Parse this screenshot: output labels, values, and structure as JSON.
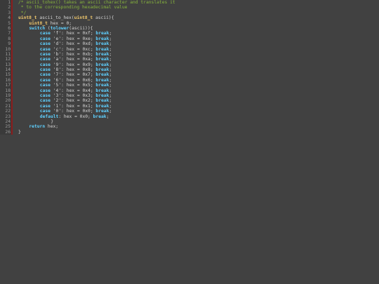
{
  "editor": {
    "lines": [
      {
        "n": "1",
        "indent": 0,
        "tokens": [
          {
            "t": "comment",
            "v": "/* ascii_tohex() takes an ascii character and translates it"
          }
        ]
      },
      {
        "n": "2",
        "indent": 0,
        "tokens": [
          {
            "t": "comment",
            "v": " * to the corresponding hexadecimal value"
          }
        ]
      },
      {
        "n": "3",
        "indent": 0,
        "tokens": [
          {
            "t": "comment",
            "v": " */"
          }
        ]
      },
      {
        "n": "4",
        "indent": 0,
        "tokens": [
          {
            "t": "type",
            "v": "uint8_t"
          },
          {
            "t": "plain",
            "v": " ascii_to_hex("
          },
          {
            "t": "type",
            "v": "uint8_t"
          },
          {
            "t": "plain",
            "v": " ascii){"
          }
        ]
      },
      {
        "n": "5",
        "indent": 4,
        "tokens": [
          {
            "t": "type",
            "v": "uint8_t"
          },
          {
            "t": "plain",
            "v": " hex = 0;"
          }
        ]
      },
      {
        "n": "6",
        "indent": 4,
        "tokens": [
          {
            "t": "kw",
            "v": "switch"
          },
          {
            "t": "plain",
            "v": " ("
          },
          {
            "t": "kw",
            "v": "tolower"
          },
          {
            "t": "plain",
            "v": "(ascii)){"
          }
        ]
      },
      {
        "n": "7",
        "indent": 8,
        "tokens": [
          {
            "t": "kw",
            "v": "case"
          },
          {
            "t": "plain",
            "v": " 'f': hex = 0xf; "
          },
          {
            "t": "kw",
            "v": "break"
          },
          {
            "t": "plain",
            "v": ";"
          }
        ]
      },
      {
        "n": "8",
        "indent": 8,
        "tokens": [
          {
            "t": "kw",
            "v": "case"
          },
          {
            "t": "plain",
            "v": " 'e': hex = 0xe; "
          },
          {
            "t": "kw",
            "v": "break"
          },
          {
            "t": "plain",
            "v": ";"
          }
        ]
      },
      {
        "n": "9",
        "indent": 8,
        "tokens": [
          {
            "t": "kw",
            "v": "case"
          },
          {
            "t": "plain",
            "v": " 'd': hex = 0xd; "
          },
          {
            "t": "kw",
            "v": "break"
          },
          {
            "t": "plain",
            "v": ";"
          }
        ]
      },
      {
        "n": "10",
        "indent": 8,
        "tokens": [
          {
            "t": "kw",
            "v": "case"
          },
          {
            "t": "plain",
            "v": " 'c': hex = 0xc; "
          },
          {
            "t": "kw",
            "v": "break"
          },
          {
            "t": "plain",
            "v": ";"
          }
        ]
      },
      {
        "n": "11",
        "indent": 8,
        "tokens": [
          {
            "t": "kw",
            "v": "case"
          },
          {
            "t": "plain",
            "v": " 'b': hex = 0xb; "
          },
          {
            "t": "kw",
            "v": "break"
          },
          {
            "t": "plain",
            "v": ";"
          }
        ]
      },
      {
        "n": "12",
        "indent": 8,
        "tokens": [
          {
            "t": "kw",
            "v": "case"
          },
          {
            "t": "plain",
            "v": " 'a': hex = 0xa; "
          },
          {
            "t": "kw",
            "v": "break"
          },
          {
            "t": "plain",
            "v": ";"
          }
        ]
      },
      {
        "n": "13",
        "indent": 8,
        "tokens": [
          {
            "t": "kw",
            "v": "case"
          },
          {
            "t": "plain",
            "v": " '9': hex = 0x9; "
          },
          {
            "t": "kw",
            "v": "break"
          },
          {
            "t": "plain",
            "v": ";"
          }
        ]
      },
      {
        "n": "14",
        "indent": 8,
        "tokens": [
          {
            "t": "kw",
            "v": "case"
          },
          {
            "t": "plain",
            "v": " '8': hex = 0x8; "
          },
          {
            "t": "kw",
            "v": "break"
          },
          {
            "t": "plain",
            "v": ";"
          }
        ]
      },
      {
        "n": "15",
        "indent": 8,
        "tokens": [
          {
            "t": "kw",
            "v": "case"
          },
          {
            "t": "plain",
            "v": " '7': hex = 0x7; "
          },
          {
            "t": "kw",
            "v": "break"
          },
          {
            "t": "plain",
            "v": ";"
          }
        ]
      },
      {
        "n": "16",
        "indent": 8,
        "tokens": [
          {
            "t": "kw",
            "v": "case"
          },
          {
            "t": "plain",
            "v": " '6': hex = 0x6; "
          },
          {
            "t": "kw",
            "v": "break"
          },
          {
            "t": "plain",
            "v": ";"
          }
        ]
      },
      {
        "n": "17",
        "indent": 8,
        "tokens": [
          {
            "t": "kw",
            "v": "case"
          },
          {
            "t": "plain",
            "v": " '5': hex = 0x5; "
          },
          {
            "t": "kw",
            "v": "break"
          },
          {
            "t": "plain",
            "v": ";"
          }
        ]
      },
      {
        "n": "18",
        "indent": 8,
        "tokens": [
          {
            "t": "kw",
            "v": "case"
          },
          {
            "t": "plain",
            "v": " '4': hex = 0x4; "
          },
          {
            "t": "kw",
            "v": "break"
          },
          {
            "t": "plain",
            "v": ";"
          }
        ]
      },
      {
        "n": "19",
        "indent": 8,
        "tokens": [
          {
            "t": "kw",
            "v": "case"
          },
          {
            "t": "plain",
            "v": " '3': hex = 0x3; "
          },
          {
            "t": "kw",
            "v": "break"
          },
          {
            "t": "plain",
            "v": ";"
          }
        ]
      },
      {
        "n": "20",
        "indent": 8,
        "tokens": [
          {
            "t": "kw",
            "v": "case"
          },
          {
            "t": "plain",
            "v": " '2': hex = 0x2; "
          },
          {
            "t": "kw",
            "v": "break"
          },
          {
            "t": "plain",
            "v": ";"
          }
        ]
      },
      {
        "n": "21",
        "indent": 8,
        "tokens": [
          {
            "t": "kw",
            "v": "case"
          },
          {
            "t": "plain",
            "v": " '1': hex = 0x1; "
          },
          {
            "t": "kw",
            "v": "break"
          },
          {
            "t": "plain",
            "v": ";"
          }
        ]
      },
      {
        "n": "22",
        "indent": 8,
        "tokens": [
          {
            "t": "kw",
            "v": "case"
          },
          {
            "t": "plain",
            "v": " '0': hex = 0x0; "
          },
          {
            "t": "kw",
            "v": "break"
          },
          {
            "t": "plain",
            "v": ";"
          }
        ]
      },
      {
        "n": "23",
        "indent": 8,
        "tokens": [
          {
            "t": "kw",
            "v": "default"
          },
          {
            "t": "plain",
            "v": ": hex = 0x0; "
          },
          {
            "t": "kw",
            "v": "break"
          },
          {
            "t": "plain",
            "v": ";"
          }
        ]
      },
      {
        "n": "24",
        "indent": 12,
        "tokens": [
          {
            "t": "plain",
            "v": "}"
          }
        ]
      },
      {
        "n": "25",
        "indent": 4,
        "tokens": [
          {
            "t": "kw",
            "v": "return"
          },
          {
            "t": "plain",
            "v": " hex;"
          }
        ]
      },
      {
        "n": "26",
        "indent": 0,
        "tokens": [
          {
            "t": "plain",
            "v": "}"
          }
        ]
      }
    ]
  },
  "colors": {
    "background": "#414141",
    "gutter_border": "#8c1c1c",
    "comment": "#86b43c",
    "type": "#f0c86c",
    "keyword": "#5fd0ff",
    "text": "#d6d6d6",
    "line_number": "#9a9a9a"
  }
}
